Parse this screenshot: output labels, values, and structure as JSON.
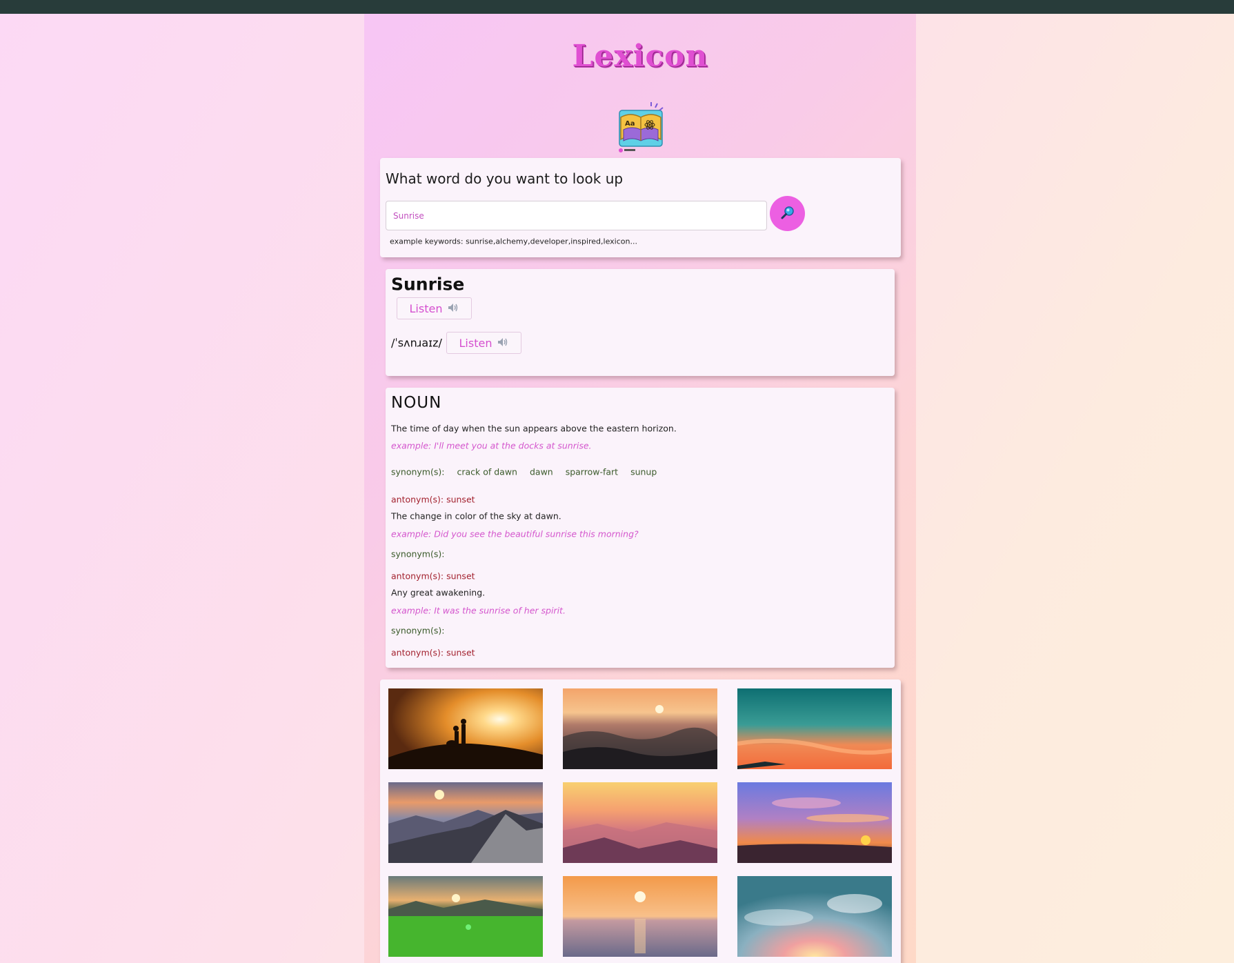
{
  "app": {
    "title": "Lexicon",
    "logo_icon": "book-atom-logo"
  },
  "search": {
    "heading": "What word do you want to look up",
    "value": "Sunrise",
    "button_icon": "magnifier-icon",
    "examples": "example keywords: sunrise,alchemy,developer,inspired,lexicon..."
  },
  "word": {
    "title": "Sunrise",
    "listen_label": "Listen",
    "phonetic": "/ˈsʌnɹaɪz/",
    "phonetic_listen_label": "Listen",
    "speaker_icon": "speaker-icon"
  },
  "meaning": {
    "part_of_speech": "NOUN",
    "definitions": [
      {
        "definition": "The time of day when the sun appears above the eastern horizon.",
        "example": "example: I'll meet you at the docks at sunrise.",
        "synonym_label": "synonym(s):",
        "synonyms": [
          "crack of dawn",
          "dawn",
          "sparrow-fart",
          "sunup"
        ],
        "antonyms": "antonym(s): sunset"
      },
      {
        "definition": "The change in color of the sky at dawn.",
        "example": "example: Did you see the beautiful sunrise this morning?",
        "synonym_label": "synonym(s):",
        "antonyms": "antonym(s): sunset"
      },
      {
        "definition": "Any great awakening.",
        "example": "example: It was the sunrise of her spirit.",
        "synonym_label": "synonym(s):",
        "antonyms": "antonym(s): sunset"
      }
    ]
  },
  "gallery": {
    "images": [
      "sunset-couple",
      "ocean-wave-sunset",
      "teal-orange-sky",
      "mountain-sunrise",
      "pastel-mountains",
      "purple-sky-sunset",
      "green-field-sunrise",
      "sea-sunrise",
      "cloudy-sky-sunrise"
    ]
  },
  "colors": {
    "accent": "#ec5fe2",
    "brand_text": "#e04fd2",
    "example_text": "#d456cd",
    "antonym_text": "#a3222f",
    "synonym_text": "#3a5a2a",
    "topbar": "#283c3a"
  }
}
